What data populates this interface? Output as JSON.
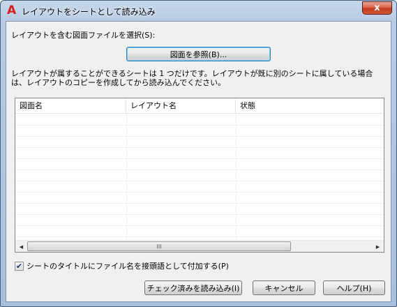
{
  "window": {
    "title": "レイアウトをシートとして読み込み",
    "app_icon": "A",
    "close_glyph": "x"
  },
  "select_label": "レイアウトを含む図面ファイルを選択(S):",
  "browse_button": "図面を参照(B)...",
  "info_text": "レイアウトが属することができるシートは 1 つだけです。レイアウトが既に別のシートに属している場合は、レイアウトのコピーを作成してから読み込んでください。",
  "table": {
    "columns": [
      "図面名",
      "レイアウト名",
      "状態"
    ],
    "rows": [],
    "scroll_left": "◀",
    "scroll_right": "▶",
    "thumb_grip": "III"
  },
  "checkbox": {
    "label": "シートのタイトルにファイル名を接頭語として付加する(P)",
    "checked": true,
    "check_glyph": "✔"
  },
  "buttons": {
    "load": "チェック済みを読み込み(I)",
    "cancel": "キャンセル",
    "help": "ヘルプ(H)"
  }
}
